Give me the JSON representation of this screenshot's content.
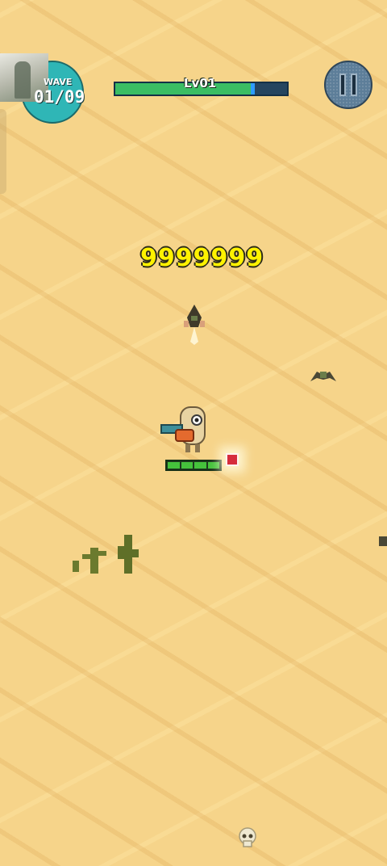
{
  "hud": {
    "wave_label": "WAVE",
    "wave_count": "01/09",
    "level_label": "Lv01",
    "xp_progress": 0.79,
    "pause_icon": "pause-icon"
  },
  "score": {
    "value": "9999999"
  },
  "player": {
    "health_segments": 4,
    "health_fraction": 1.0
  },
  "colors": {
    "sand": "#f6d48a",
    "wave_badge": "#2fb6b6",
    "xp_green": "#3bbd63",
    "xp_blue": "#2e9cff",
    "score_yellow": "#fff200",
    "health_green": "#45c23c",
    "gem_red": "#d62c3c"
  }
}
